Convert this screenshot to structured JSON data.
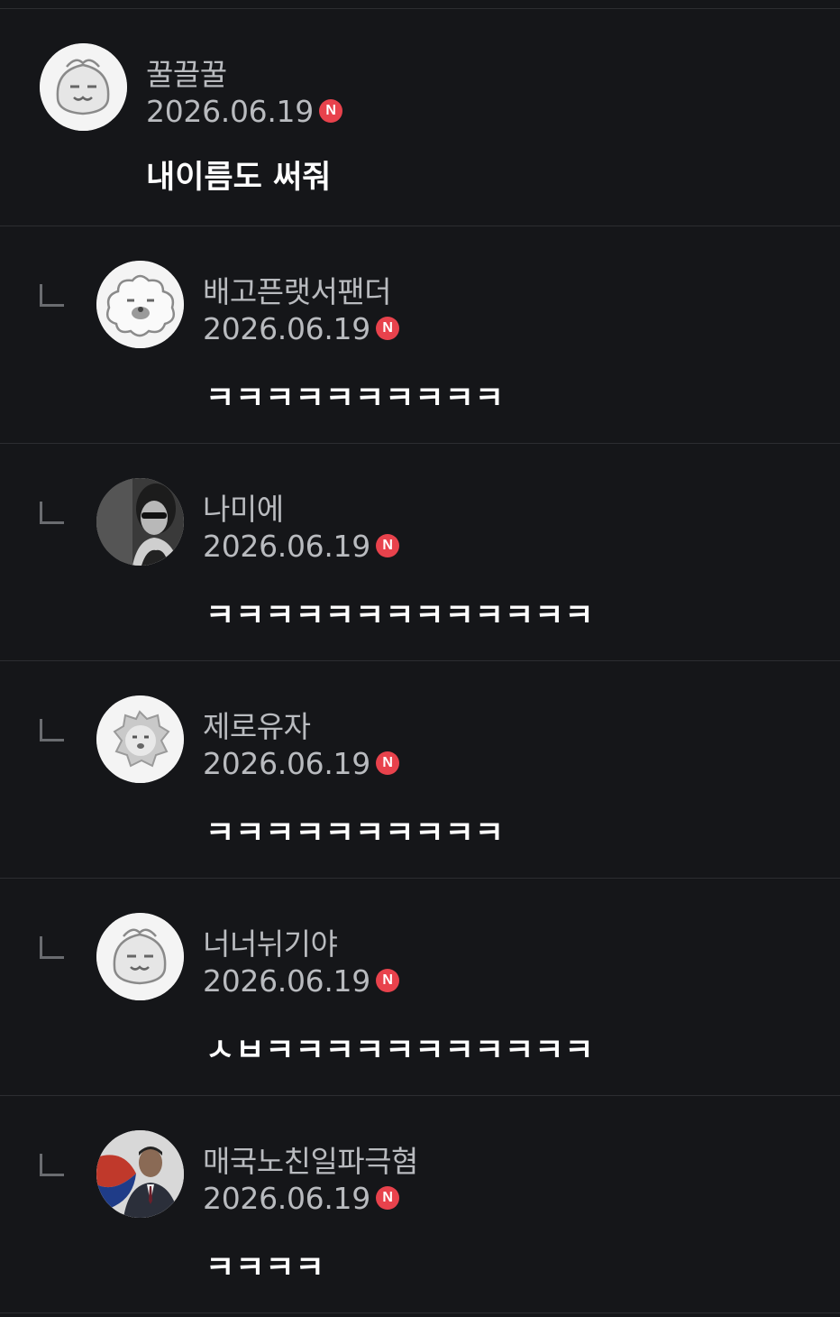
{
  "comments": [
    {
      "nickname": "꿀끌꿀",
      "date": "2026.06.19",
      "badge": "N",
      "text": "내이름도 써줘",
      "avatar": "grumpy-plant-avatar"
    },
    {
      "nickname": "배고픈랫서팬더",
      "date": "2026.06.19",
      "badge": "N",
      "text": "ㅋㅋㅋㅋㅋㅋㅋㅋㅋㅋ",
      "avatar": "fluffy-sheep-avatar"
    },
    {
      "nickname": "나미에",
      "date": "2026.06.19",
      "badge": "N",
      "text": "ㅋㅋㅋㅋㅋㅋㅋㅋㅋㅋㅋㅋㅋ",
      "avatar": "photo-woman-sunglasses-avatar"
    },
    {
      "nickname": "제로유자",
      "date": "2026.06.19",
      "badge": "N",
      "text": "ㅋㅋㅋㅋㅋㅋㅋㅋㅋㅋ",
      "avatar": "lion-face-avatar"
    },
    {
      "nickname": "너너뉘기야",
      "date": "2026.06.19",
      "badge": "N",
      "text": "ㅅㅂㅋㅋㅋㅋㅋㅋㅋㅋㅋㅋㅋ",
      "avatar": "grumpy-plant-avatar"
    },
    {
      "nickname": "매국노친일파극혐",
      "date": "2026.06.19",
      "badge": "N",
      "text": "ㅋㅋㅋㅋ",
      "avatar": "photo-man-flag-avatar"
    }
  ],
  "colors": {
    "background": "#151619",
    "divider": "#2c2d31",
    "badge": "#e8424c",
    "meta": "#b9bbbf"
  }
}
